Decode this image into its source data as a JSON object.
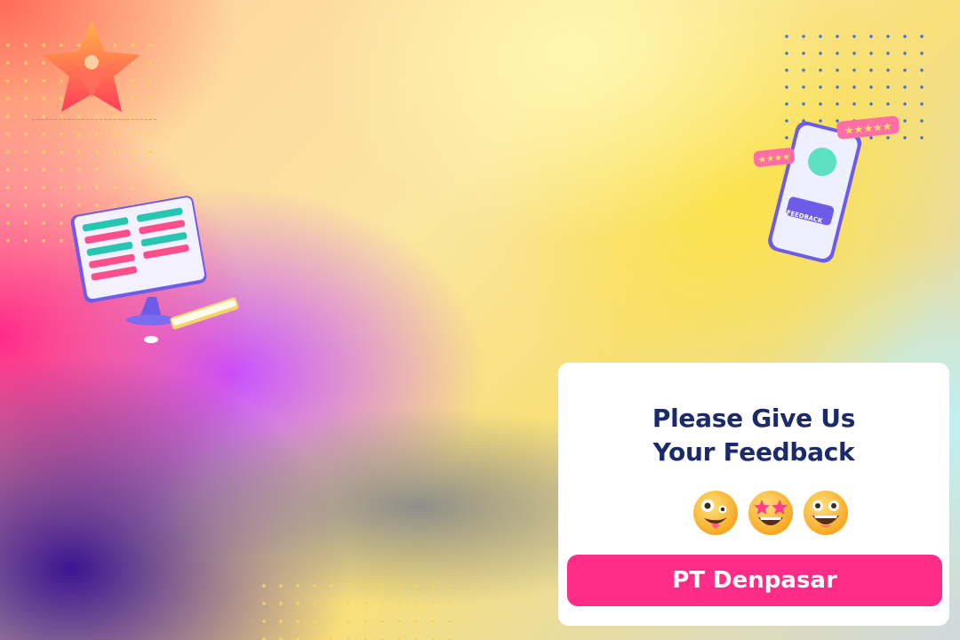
{
  "card": {
    "title_line1": "Please Give Us",
    "title_line2": "Your Feedback",
    "emoji_icons": [
      "zany-face-icon",
      "star-struck-face-icon",
      "grinning-face-icon"
    ],
    "button_label": "PT Denpasar"
  },
  "phone": {
    "button_label": "FEEDBACK",
    "ratings": [
      "5-stars",
      "4-stars"
    ]
  },
  "colors": {
    "title": "#1b2a6b",
    "button": "#ff2d87",
    "card_bg": "#ffffff",
    "dots_yellow": "#f2c94c",
    "dots_blue": "#3a6fd8"
  }
}
